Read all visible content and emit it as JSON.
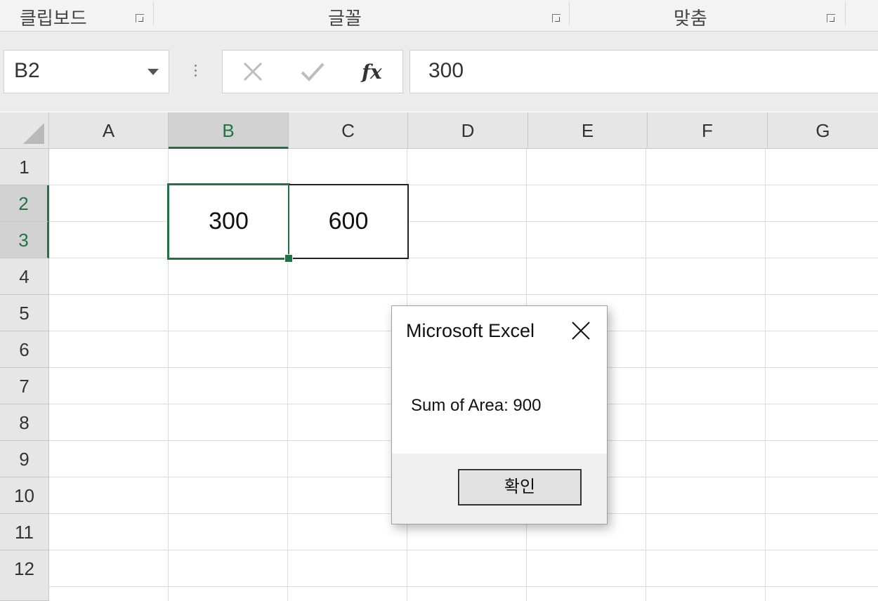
{
  "ribbon": {
    "groups": [
      {
        "label": "클립보드"
      },
      {
        "label": "글꼴"
      },
      {
        "label": "맞춤"
      }
    ]
  },
  "formula_bar": {
    "name_box": "B2",
    "cancel_icon": "x-icon",
    "enter_icon": "check-icon",
    "fx_label": "fx",
    "formula_value": "300"
  },
  "grid": {
    "columns": [
      "A",
      "B",
      "C",
      "D",
      "E",
      "F",
      "G"
    ],
    "rows": [
      "1",
      "2",
      "3",
      "4",
      "5",
      "6",
      "7",
      "8",
      "9",
      "10",
      "11",
      "12"
    ],
    "selected_column": "B",
    "selected_rows": [
      "2",
      "3"
    ],
    "cells": {
      "B2": "300",
      "C2": "600"
    }
  },
  "dialog": {
    "title": "Microsoft Excel",
    "message": "Sum of Area: 900",
    "ok_label": "확인"
  },
  "colors": {
    "accent": "#217346",
    "header_bg": "#e6e6e6",
    "selected_header_bg": "#d2d2d2"
  }
}
